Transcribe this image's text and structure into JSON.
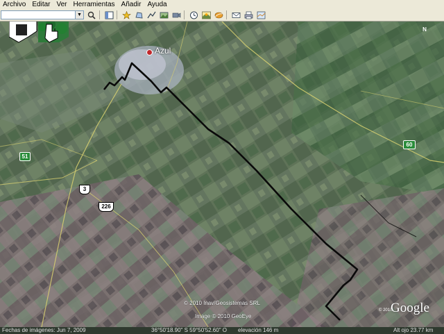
{
  "menu": {
    "items": [
      "Archivo",
      "Editar",
      "Ver",
      "Herramientas",
      "Añadir",
      "Ayuda"
    ]
  },
  "toolbar": {
    "search": {
      "value": "",
      "placeholder": ""
    },
    "buttons": [
      "sidebar-toggle-icon",
      "placemark-icon",
      "polygon-icon",
      "path-icon",
      "image-overlay-icon",
      "record-tour-icon",
      "historical-imagery-icon",
      "sunlight-icon",
      "planet-icon",
      "email-icon",
      "print-icon",
      "view-in-maps-icon"
    ]
  },
  "map": {
    "city_label": "Azul",
    "roads": [
      {
        "number": "51",
        "type": "provincial"
      },
      {
        "number": "3",
        "type": "national"
      },
      {
        "number": "226",
        "type": "national"
      },
      {
        "number": "60",
        "type": "provincial"
      }
    ],
    "compass_label": "N",
    "copyright": "© 2010 Inav/Geosistemas SRL",
    "image_credit": "Image © 2010 GeoEye",
    "year_mark": "© 2010",
    "logo_text": "Google"
  },
  "status": {
    "imagery_date": "Fechas de imágenes: Jun 7, 2009",
    "coords": "36°50'18.90\" S    59°50'52.60\" O",
    "elevation": "elevación 146 m",
    "eye_alt": "Alt ojo  23.77 km"
  },
  "colors": {
    "path": "#0a0a0a",
    "road": "#d8d070",
    "highway_shield": "#2a8c3a",
    "city_dot": "#c0282c"
  }
}
